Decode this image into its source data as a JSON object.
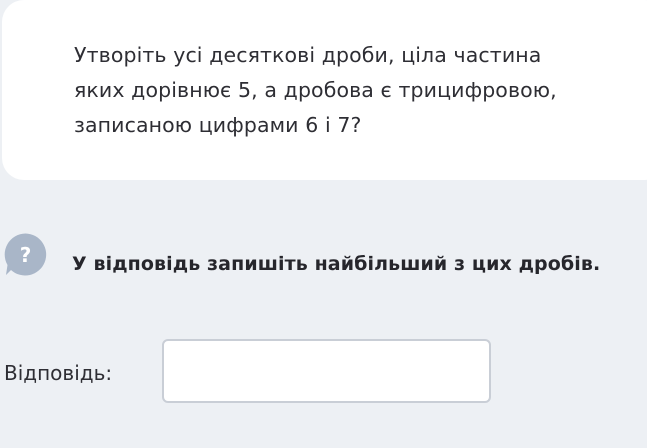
{
  "question": {
    "line1": "Утворіть усі десяткові дроби, ціла частина",
    "line2": "яких дорівнює 5, а дробова є трицифровою,",
    "line3": "записаною цифрами 6 і 7?"
  },
  "hint": {
    "icon": "question-icon",
    "icon_glyph": "?",
    "icon_color": "#a9b6c8",
    "text": "У відповідь запишіть найбільший з цих дробів."
  },
  "answer": {
    "label": "Відповідь:",
    "value": ""
  }
}
